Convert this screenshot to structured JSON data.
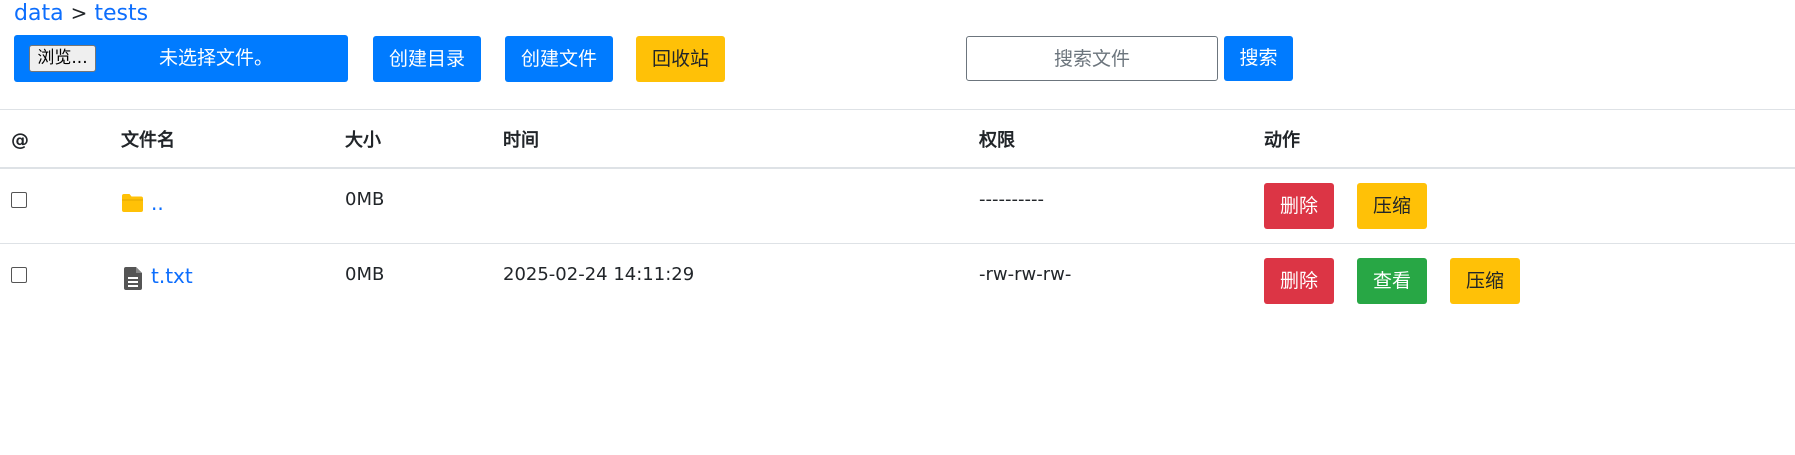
{
  "breadcrumb": {
    "items": [
      "data",
      "tests"
    ],
    "separator": ">"
  },
  "toolbar": {
    "browse_label": "浏览...",
    "no_file_label": "未选择文件。",
    "create_dir_label": "创建目录",
    "create_file_label": "创建文件",
    "recycle_label": "回收站",
    "search_placeholder": "搜索文件",
    "search_button_label": "搜索"
  },
  "table": {
    "headers": {
      "select": "@",
      "name": "文件名",
      "size": "大小",
      "time": "时间",
      "permission": "权限",
      "action": "动作"
    },
    "rows": [
      {
        "type": "folder",
        "icon": "folder-icon",
        "name": "..",
        "size": "0MB",
        "time": "",
        "permission": "----------",
        "actions": {
          "delete": "删除",
          "compress": "压缩"
        }
      },
      {
        "type": "file",
        "icon": "file-text-icon",
        "name": "t.txt",
        "size": "0MB",
        "time": "2025-02-24 14:11:29",
        "permission": "-rw-rw-rw-",
        "actions": {
          "delete": "删除",
          "view": "查看",
          "compress": "压缩"
        }
      }
    ]
  },
  "colors": {
    "primary": "#007bff",
    "warning": "#ffc107",
    "danger": "#dc3545",
    "success": "#28a745",
    "link": "#0d6efd",
    "folder": "#ffc107",
    "file_icon": "#555555"
  }
}
